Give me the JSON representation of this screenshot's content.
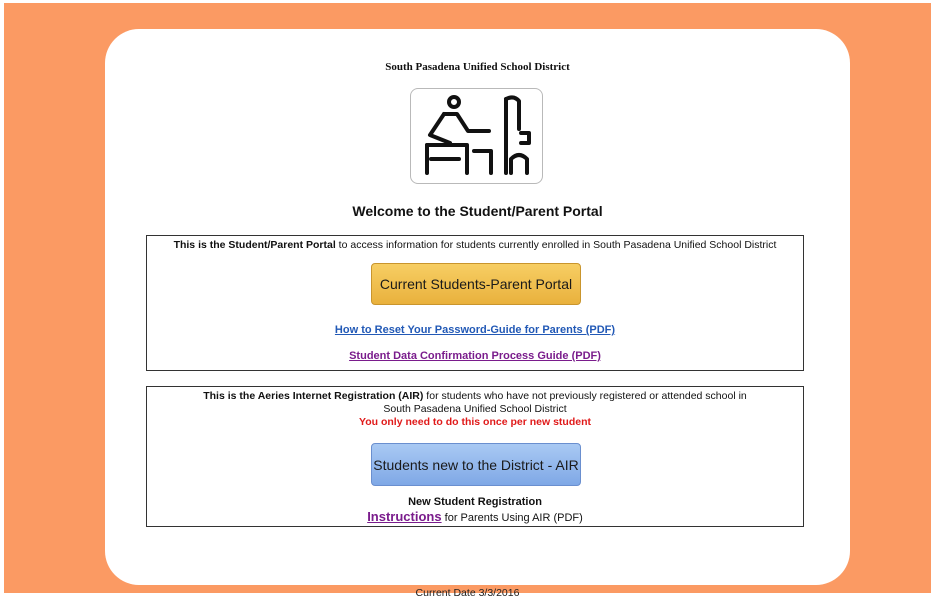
{
  "header": {
    "district_name": "South Pasadena Unified School District",
    "welcome_title": "Welcome to the Student/Parent Portal"
  },
  "logo": {
    "icon": "student-at-desk-icon"
  },
  "portal_section": {
    "intro_bold": "This is the Student/Parent Portal",
    "intro_rest": " to access information for students currently enrolled in South Pasadena Unified School District",
    "button_label": "Current Students-Parent Portal",
    "link_reset_password": "How to Reset Your Password-Guide for Parents (PDF)",
    "link_data_confirmation": "Student Data Confirmation Process Guide (PDF)"
  },
  "air_section": {
    "intro_bold": "This is the Aeries Internet Registration (AIR)",
    "intro_rest": " for students who have not previously registered or attended school in",
    "intro_line2": "South Pasadena Unified School District",
    "notice": "You only need to do this once per new student",
    "button_label": "Students new to the District - AIR",
    "new_reg_title": "New Student Registration",
    "instructions_link": "Instructions",
    "instructions_rest": " for Parents Using AIR (PDF)"
  },
  "footer": {
    "current_date": "Current Date 3/3/2016"
  },
  "colors": {
    "page_background": "#fb9a63",
    "gold_button": "#f0bf4f",
    "blue_button": "#94b8ec",
    "link_blue": "#2259b6",
    "link_purple": "#7a1c8c",
    "notice_red": "#e01a1a"
  }
}
